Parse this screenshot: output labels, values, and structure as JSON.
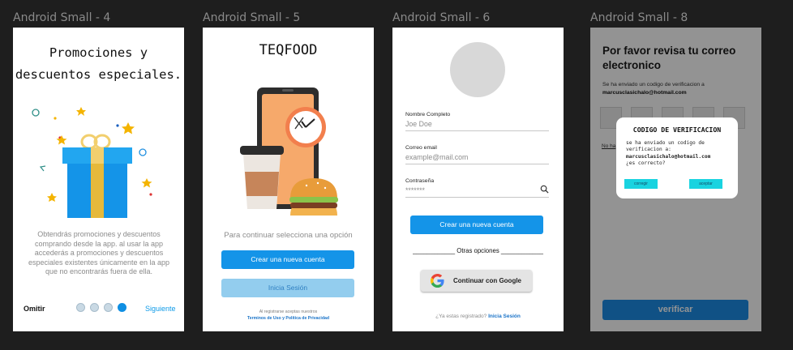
{
  "canvas": {
    "frame_labels": [
      "Android Small - 4",
      "Android Small - 5",
      "Android Small - 6",
      "Android Small - 8"
    ]
  },
  "screen4": {
    "title_line1": "Promociones y",
    "title_line2": "descuentos especiales.",
    "illustration_icon": "gift-icon",
    "body": "Obtendrás promociones y descuentos comprando desde la app. al usar la app accederás a promociones y descuentos especiales existentes únicamente en la app que no encontrarás fuera de ella.",
    "skip": "Omitir",
    "next": "Siguiente",
    "page_count": 4,
    "active_page": 4,
    "colors": {
      "accent": "#0f8fe3"
    }
  },
  "screen5": {
    "brand": "TEQFOOD",
    "illustration_icon": "phone-clock-coffee-burger-icon",
    "prompt": "Para continuar selecciona una opción",
    "create_account": "Crear una nueva cuenta",
    "login": "Inicia Sesión",
    "legal_prefix": "Al registrarse aceptas nuestros",
    "legal_links": "Terminos de Uso y Política de Privacidad"
  },
  "screen6": {
    "fields": [
      {
        "label": "Nombre Completo",
        "placeholder": "Joe Doe"
      },
      {
        "label": "Correo email",
        "placeholder": "example@mail.com"
      },
      {
        "label": "Contraseña",
        "placeholder": "*******"
      }
    ],
    "create_account": "Crear una nueva cuenta",
    "divider_text": "____________ Otras opciones ____________",
    "google_button": "Continuar con Google",
    "already_prefix": "¿Ya estas registrado?",
    "already_link": "Inicia Sesión"
  },
  "screen8": {
    "heading": "Por favor revisa tu correo electronico",
    "sent_text": "Se ha enviado un codigo de verificacion a",
    "email": "marcusclasichalo@hotmail.com",
    "resend": "No ha",
    "verify": "verificar",
    "code_boxes": 5,
    "modal": {
      "title": "CODIGO DE VERIFICACION",
      "line1": "se ha enviado un codigo de",
      "line2": "verificacion a:",
      "email": "marcusclasichalo@hotmail.com",
      "question": "¿es correcto?",
      "correct_btn": "corregir",
      "accept_btn": "aceptar"
    }
  }
}
